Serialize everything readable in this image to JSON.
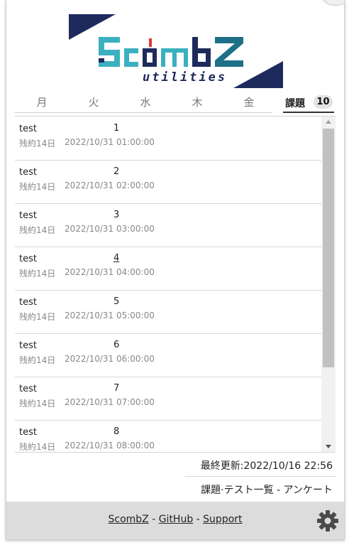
{
  "logo": {
    "title": "ScombZ",
    "subtitle": "utilities"
  },
  "tabs": {
    "days": [
      "月",
      "火",
      "水",
      "木",
      "金"
    ],
    "task_label": "課題",
    "task_count": "10"
  },
  "tasks": [
    {
      "course": "test",
      "title": "1",
      "remaining": "残約14日",
      "deadline": "2022/10/31 01:00:00",
      "title_underlined": false
    },
    {
      "course": "test",
      "title": "2",
      "remaining": "残約14日",
      "deadline": "2022/10/31 02:00:00",
      "title_underlined": false
    },
    {
      "course": "test",
      "title": "3",
      "remaining": "残約14日",
      "deadline": "2022/10/31 03:00:00",
      "title_underlined": false
    },
    {
      "course": "test",
      "title": "4",
      "remaining": "残約14日",
      "deadline": "2022/10/31 04:00:00",
      "title_underlined": true
    },
    {
      "course": "test",
      "title": "5",
      "remaining": "残約14日",
      "deadline": "2022/10/31 05:00:00",
      "title_underlined": false
    },
    {
      "course": "test",
      "title": "6",
      "remaining": "残約14日",
      "deadline": "2022/10/31 06:00:00",
      "title_underlined": false
    },
    {
      "course": "test",
      "title": "7",
      "remaining": "残約14日",
      "deadline": "2022/10/31 07:00:00",
      "title_underlined": false
    },
    {
      "course": "test",
      "title": "8",
      "remaining": "残約14日",
      "deadline": "2022/10/31 08:00:00",
      "title_underlined": false
    }
  ],
  "footer": {
    "last_updated": "最終更新:2022/10/16 22:56",
    "list_link": "課題·テスト一覧 - アンケート",
    "links": [
      "ScombZ",
      "GitHub",
      "Support"
    ],
    "separator": " - ",
    "settings_icon": "gear-icon"
  },
  "colors": {
    "navy": "#1e2a5c",
    "teal": "#3ab0c0",
    "red": "#e03a2a",
    "bar": "#dcdcdc"
  }
}
